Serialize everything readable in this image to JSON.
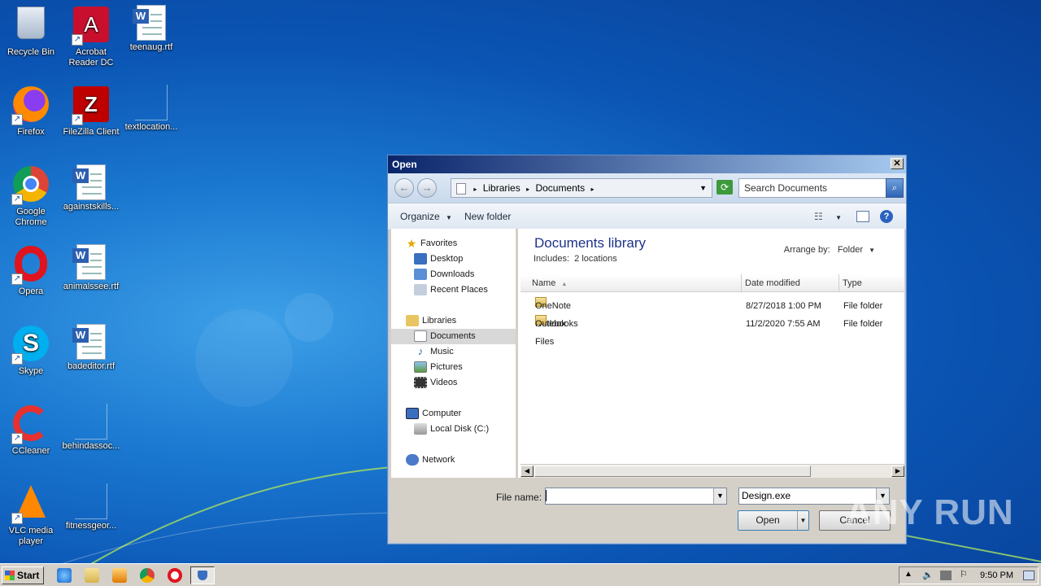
{
  "desktop": {
    "icons": [
      {
        "label": "Recycle Bin"
      },
      {
        "label": "Acrobat\nReader DC"
      },
      {
        "label": "teenaug.rtf"
      },
      {
        "label": "Firefox"
      },
      {
        "label": "FileZilla Client"
      },
      {
        "label": "textlocation..."
      },
      {
        "label": "Google\nChrome"
      },
      {
        "label": "againstskills..."
      },
      {
        "label": "Opera"
      },
      {
        "label": "animalssee.rtf"
      },
      {
        "label": "Skype"
      },
      {
        "label": "badeditor.rtf"
      },
      {
        "label": "CCleaner"
      },
      {
        "label": "behindassoc..."
      },
      {
        "label": "VLC media\nplayer"
      },
      {
        "label": "fitnessgeor..."
      }
    ]
  },
  "dialog": {
    "title": "Open",
    "close_glyph": "✕",
    "address": {
      "crumb1": "Libraries",
      "crumb2": "Documents",
      "sep": "▸"
    },
    "search_placeholder": "Search Documents",
    "toolbar": {
      "organize": "Organize",
      "new_folder": "New folder"
    },
    "nav": {
      "favorites": "Favorites",
      "desktop": "Desktop",
      "downloads": "Downloads",
      "recent": "Recent Places",
      "libraries": "Libraries",
      "documents": "Documents",
      "music": "Music",
      "pictures": "Pictures",
      "videos": "Videos",
      "computer": "Computer",
      "local_disk": "Local Disk (C:)",
      "network": "Network"
    },
    "library": {
      "title": "Documents library",
      "includes": "Includes:",
      "locations": "2 locations",
      "arrange_by": "Arrange by:",
      "arrange_value": "Folder"
    },
    "columns": {
      "name": "Name",
      "date": "Date modified",
      "type": "Type"
    },
    "files": [
      {
        "name": "OneNote Notebooks",
        "date": "8/27/2018 1:00 PM",
        "type": "File folder"
      },
      {
        "name": "Outlook Files",
        "date": "11/2/2020 7:55 AM",
        "type": "File folder"
      }
    ],
    "file_name_label": "File name:",
    "file_name_value": "",
    "file_type": "Design.exe",
    "open_label": "Open",
    "cancel_label": "Cancel"
  },
  "taskbar": {
    "start": "Start",
    "clock": "9:50 PM"
  },
  "watermark": "ANY RUN"
}
